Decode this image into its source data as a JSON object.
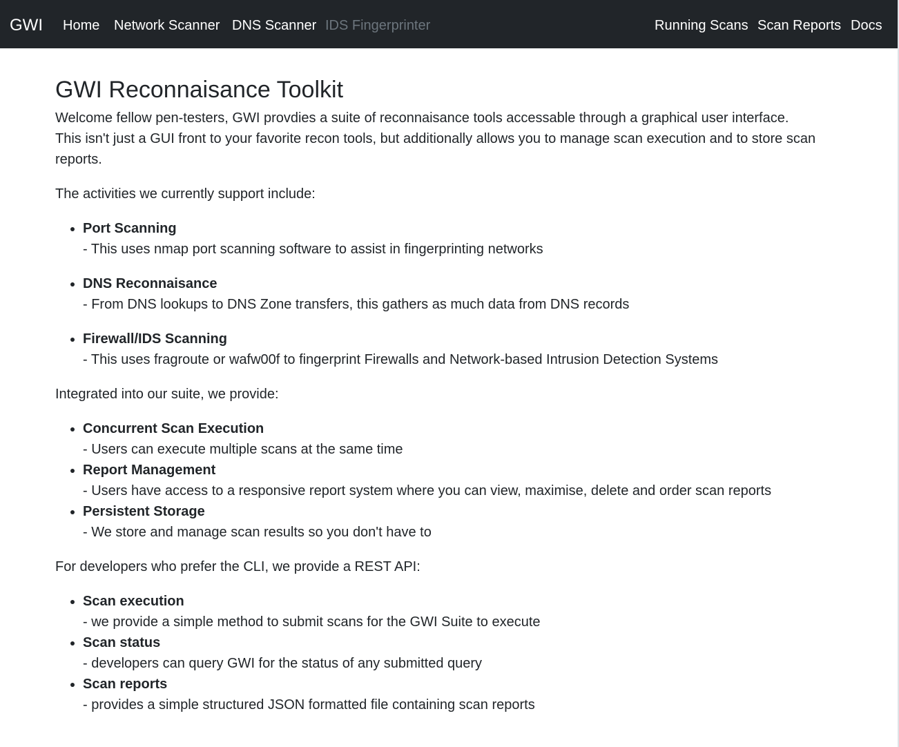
{
  "navbar": {
    "brand": "GWI",
    "left_links": [
      "Home",
      "Network Scanner",
      "DNS Scanner",
      "IDS Fingerprinter"
    ],
    "right_links": [
      "Running Scans",
      "Scan Reports",
      "Docs"
    ],
    "disabled_link": "IDS Fingerprinter"
  },
  "main": {
    "title": "GWI Reconnaisance Toolkit",
    "intro_line1": "Welcome fellow pen-testers, GWI provdies a suite of reconnaisance tools accessable through a graphical user interface.",
    "intro_line2": "This isn't just a GUI front to your favorite recon tools, but additionally allows you to manage scan execution and to store scan reports.",
    "activities_heading": "The activities we currently support include:",
    "activities": [
      {
        "title": "Port Scanning",
        "desc": "- This uses nmap port scanning software to assist in fingerprinting networks"
      },
      {
        "title": "DNS Reconnaisance",
        "desc": "- From DNS lookups to DNS Zone transfers, this gathers as much data from DNS records"
      },
      {
        "title": "Firewall/IDS Scanning",
        "desc": "- This uses fragroute or wafw00f to fingerprint Firewalls and Network-based Intrusion Detection Systems"
      }
    ],
    "integrated_heading": "Integrated into our suite, we provide:",
    "integrated": [
      {
        "title": "Concurrent Scan Execution",
        "desc": "- Users can execute multiple scans at the same time"
      },
      {
        "title": "Report Management",
        "desc": "- Users have access to a responsive report system where you can view, maximise, delete and order scan reports"
      },
      {
        "title": "Persistent Storage",
        "desc": "- We store and manage scan results so you don't have to"
      }
    ],
    "api_heading": "For developers who prefer the CLI, we provide a REST API:",
    "api": [
      {
        "title": "Scan execution",
        "desc": "- we provide a simple method to submit scans for the GWI Suite to execute"
      },
      {
        "title": "Scan status",
        "desc": "- developers can query GWI for the status of any submitted query"
      },
      {
        "title": "Scan reports",
        "desc": "- provides a simple structured JSON formatted file containing scan reports"
      }
    ]
  },
  "colors": {
    "navbar_bg": "#212529",
    "nav_text": "#ffffff",
    "nav_disabled": "#6c757d",
    "body_text": "#212529"
  }
}
